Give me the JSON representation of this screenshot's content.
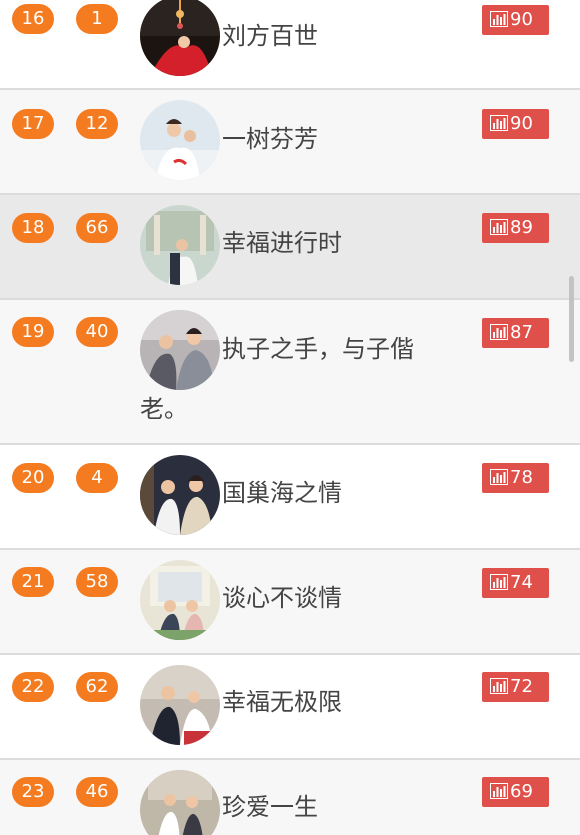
{
  "accent": "#f47b20",
  "vote_color": "#e0504a",
  "icons": {
    "vote": "bar-chart-icon"
  },
  "rows": [
    {
      "rank": "16",
      "number": "1",
      "name": "刘方百世",
      "votes": "90"
    },
    {
      "rank": "17",
      "number": "12",
      "name": "一树芬芳",
      "votes": "90"
    },
    {
      "rank": "18",
      "number": "66",
      "name": "幸福进行时",
      "votes": "89"
    },
    {
      "rank": "19",
      "number": "40",
      "name": "执子之手，与子偕老。",
      "votes": "87"
    },
    {
      "rank": "20",
      "number": "4",
      "name": "国巢海之情",
      "votes": "78"
    },
    {
      "rank": "21",
      "number": "58",
      "name": "谈心不谈情",
      "votes": "74"
    },
    {
      "rank": "22",
      "number": "62",
      "name": "幸福无极限",
      "votes": "72"
    },
    {
      "rank": "23",
      "number": "46",
      "name": "珍爱一生",
      "votes": "69"
    }
  ]
}
